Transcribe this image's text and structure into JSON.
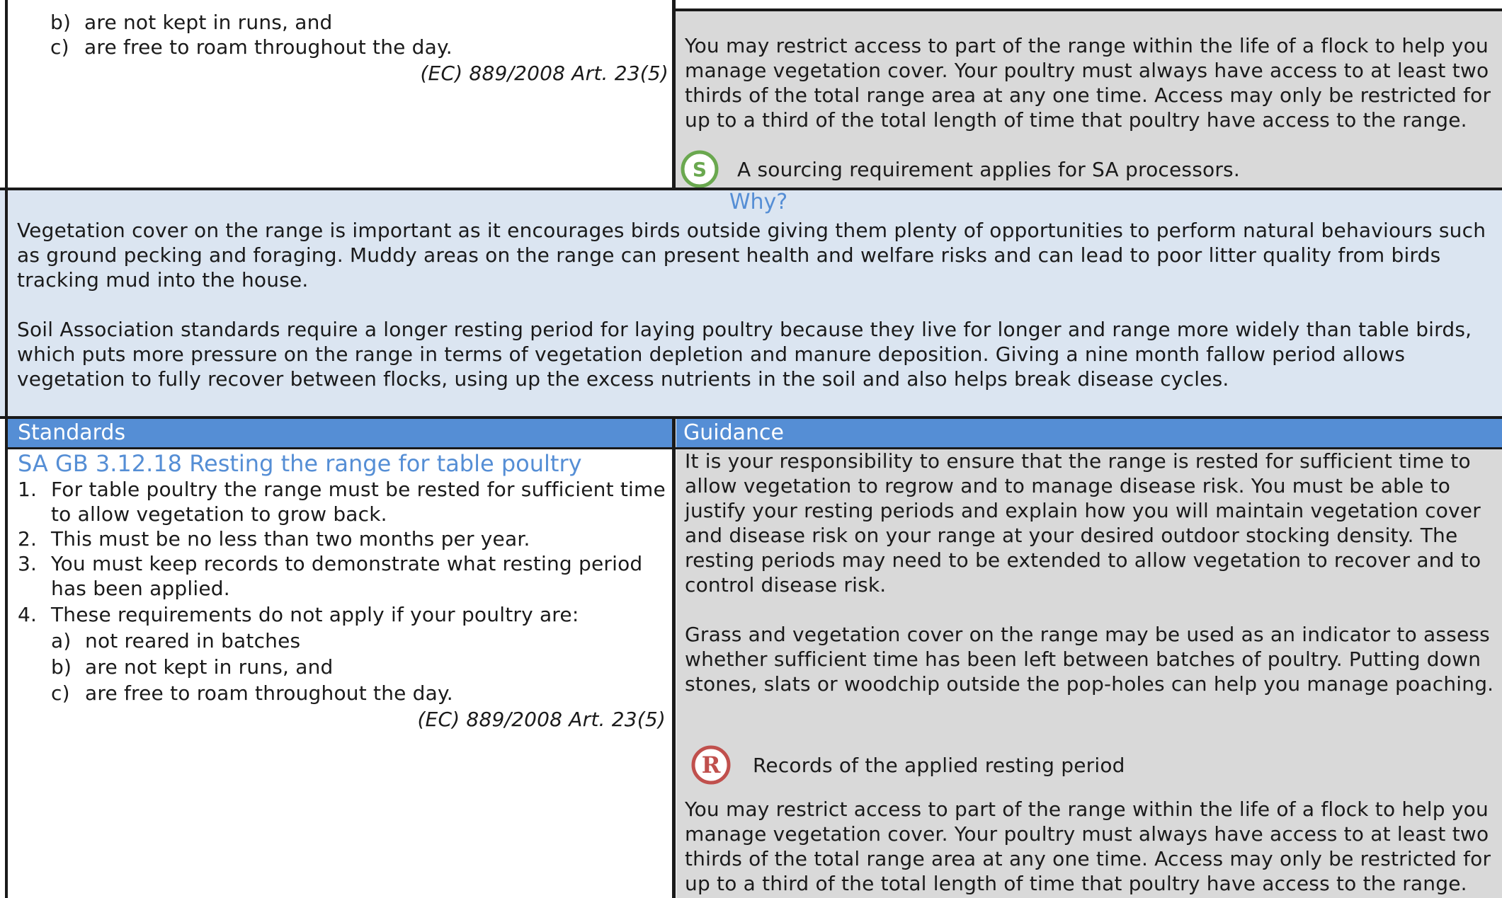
{
  "top": {
    "items": [
      {
        "marker": "b)",
        "text": "are not kept in runs, and"
      },
      {
        "marker": "c)",
        "text": "are free to roam throughout the day."
      }
    ],
    "citation": "(EC) 889/2008 Art. 23(5)",
    "guidance_text": "You may restrict access to part of the range within the life of a flock to help you manage vegetation cover. Your poultry must always have access to at least two thirds of the total range area at any one time. Access may only be restricted for up to a third of the total length of time that poultry have access to the range.",
    "sourcing_icon": "S",
    "sourcing_text": "A sourcing requirement applies for SA processors."
  },
  "why": {
    "heading": "Why?",
    "paragraphs": [
      "Vegetation cover on the range is important as it encourages birds outside giving them plenty of opportunities to perform natural behaviours such as ground pecking and foraging. Muddy areas on the range can present health and welfare risks and can lead to poor litter quality from birds tracking mud into the house.",
      "Soil Association standards require a longer resting period for laying poultry because they live for longer and range more widely than table birds, which puts more pressure on the range in terms of vegetation depletion and manure deposition. Giving a nine month fallow period allows vegetation to fully recover between flocks, using up the excess nutrients in the soil and also helps break disease cycles."
    ]
  },
  "headers": {
    "standards": "Standards",
    "guidance": "Guidance"
  },
  "standard": {
    "title": "SA GB 3.12.18 Resting the range for table poultry",
    "items": [
      {
        "marker": "1.",
        "text": "For table poultry the range must be rested for sufficient time to allow vegetation to grow back."
      },
      {
        "marker": "2.",
        "text": "This must be no less than two months per year."
      },
      {
        "marker": "3.",
        "text": "You must keep records to demonstrate what resting period has been applied."
      },
      {
        "marker": "4.",
        "text": "These requirements do not apply if your poultry are:"
      }
    ],
    "subitems": [
      {
        "marker": "a)",
        "text": "not reared in batches"
      },
      {
        "marker": "b)",
        "text": "are not kept in runs, and"
      },
      {
        "marker": "c)",
        "text": "are free to roam throughout the day."
      }
    ],
    "citation": "(EC) 889/2008 Art. 23(5)"
  },
  "guidance": {
    "para1": "It is your responsibility to ensure that the range is rested for sufficient time to allow vegetation to regrow and to manage disease risk. You must be able to justify your resting periods and explain how you will maintain vegetation cover and disease risk on your range at your desired outdoor stocking density. The resting periods may need to be extended to allow vegetation to recover and to control disease risk.",
    "para2": "Grass and vegetation cover on the range may be used as an indicator to assess whether sufficient time has been left between batches of poultry. Putting down stones, slats or woodchip outside the pop-holes can help you manage poaching.",
    "records_icon": "R",
    "records_text": "Records of the applied resting period",
    "para3": "You may restrict access to part of the range within the life of a flock to help you manage vegetation cover. Your poultry must always have access to at least two thirds of the total range area at any one time. Access may only be restricted for up to a third of the total length of time that poultry have access to the range."
  },
  "colors": {
    "header_blue": "#558ed5",
    "why_background": "#dbe5f1",
    "guidance_grey": "#d9d9d9",
    "sourcing_green": "#6aa84f",
    "records_red": "#c0504d"
  }
}
